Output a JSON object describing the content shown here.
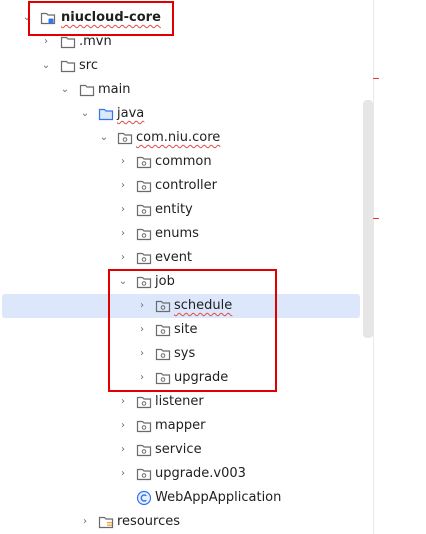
{
  "tree": [
    {
      "label": "niucloud-core",
      "bold": true,
      "squiggle": true,
      "arrow": "expanded",
      "icon": "module-folder-icon"
    },
    {
      "label": ".mvn",
      "arrow": "collapsed",
      "icon": "folder-icon"
    },
    {
      "label": "src",
      "arrow": "expanded",
      "icon": "folder-icon"
    },
    {
      "label": "main",
      "arrow": "expanded",
      "icon": "folder-icon"
    },
    {
      "label": "java",
      "squiggle": true,
      "arrow": "expanded",
      "icon": "source-folder-icon"
    },
    {
      "label": "com.niu.core",
      "squiggle": true,
      "arrow": "expanded",
      "icon": "package-icon"
    },
    {
      "label": "common",
      "arrow": "collapsed",
      "icon": "package-icon"
    },
    {
      "label": "controller",
      "arrow": "collapsed",
      "icon": "package-icon"
    },
    {
      "label": "entity",
      "arrow": "collapsed",
      "icon": "package-icon"
    },
    {
      "label": "enums",
      "arrow": "collapsed",
      "icon": "package-icon"
    },
    {
      "label": "event",
      "arrow": "collapsed",
      "icon": "package-icon"
    },
    {
      "label": "job",
      "arrow": "expanded",
      "icon": "package-icon"
    },
    {
      "label": "schedule",
      "squiggle": true,
      "arrow": "collapsed",
      "icon": "package-icon",
      "selected": true
    },
    {
      "label": "site",
      "arrow": "collapsed",
      "icon": "package-icon"
    },
    {
      "label": "sys",
      "arrow": "collapsed",
      "icon": "package-icon"
    },
    {
      "label": "upgrade",
      "arrow": "collapsed",
      "icon": "package-icon"
    },
    {
      "label": "listener",
      "arrow": "collapsed",
      "icon": "package-icon"
    },
    {
      "label": "mapper",
      "arrow": "collapsed",
      "icon": "package-icon"
    },
    {
      "label": "service",
      "arrow": "collapsed",
      "icon": "package-icon"
    },
    {
      "label": "upgrade.v003",
      "arrow": "collapsed",
      "icon": "package-icon"
    },
    {
      "label": "WebAppApplication",
      "arrow": "none",
      "icon": "class-icon"
    },
    {
      "label": "resources",
      "arrow": "collapsed",
      "icon": "resources-folder-icon"
    }
  ],
  "colors": {
    "highlight_box": "#e00000",
    "selection": "#dce7fb"
  }
}
